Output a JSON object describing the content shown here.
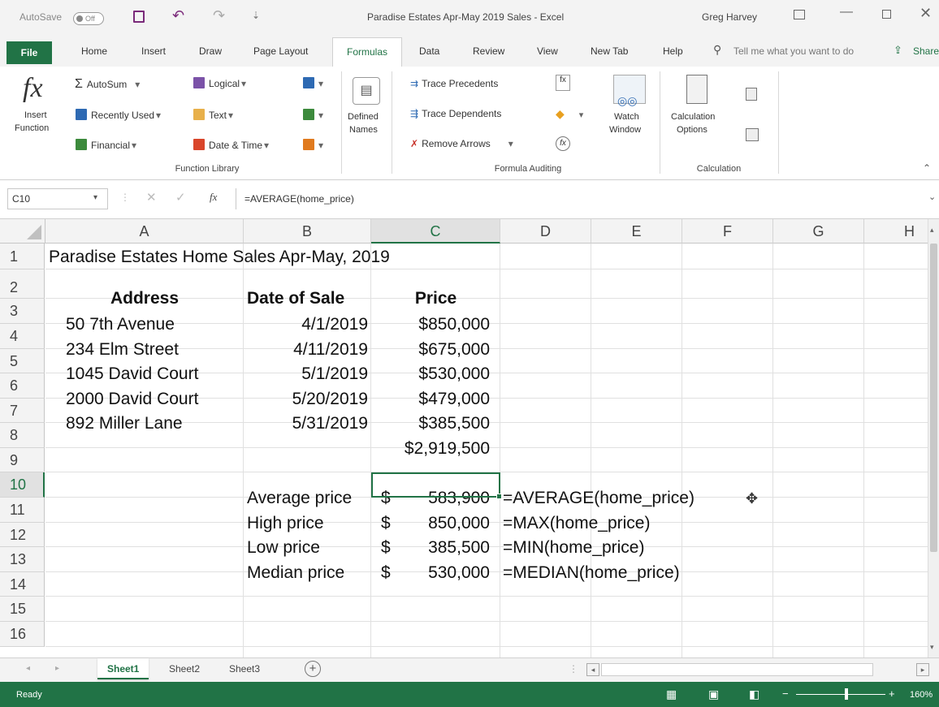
{
  "titlebar": {
    "autosave": "AutoSave",
    "autosave_state": "Off",
    "doc_title": "Paradise Estates Apr-May 2019 Sales  -  Excel",
    "user": "Greg Harvey"
  },
  "tabs": [
    "Home",
    "Insert",
    "Draw",
    "Page Layout",
    "Formulas",
    "Data",
    "Review",
    "View",
    "New Tab",
    "Help"
  ],
  "file_tab": "File",
  "active_tab": "Formulas",
  "tell_me": "Tell me what you want to do",
  "share": "Share",
  "ribbon": {
    "insert_function": [
      "Insert",
      "Function"
    ],
    "fx": "fx",
    "autosum": "AutoSum",
    "recently_used": "Recently Used",
    "financial": "Financial",
    "logical": "Logical",
    "text": "Text",
    "date_time": "Date & Time",
    "defined_names": [
      "Defined",
      "Names"
    ],
    "trace_precedents": "Trace Precedents",
    "trace_dependents": "Trace Dependents",
    "remove_arrows": "Remove Arrows",
    "watch_window": [
      "Watch",
      "Window"
    ],
    "calc_options": [
      "Calculation",
      "Options"
    ],
    "group_function_library": "Function Library",
    "group_formula_auditing": "Formula Auditing",
    "group_calculation": "Calculation"
  },
  "formula_bar": {
    "name_box": "C10",
    "fx": "fx",
    "formula": "=AVERAGE(home_price)"
  },
  "columns": [
    "A",
    "B",
    "C",
    "D",
    "E",
    "F",
    "G",
    "H"
  ],
  "rows": [
    "1",
    "2",
    "3",
    "4",
    "5",
    "6",
    "7",
    "8",
    "9",
    "10",
    "11",
    "12",
    "13",
    "14",
    "15",
    "16"
  ],
  "sheet": {
    "title": "Paradise Estates Home Sales Apr-May, 2019",
    "headers": {
      "address": "Address",
      "date": "Date of Sale",
      "price": "Price"
    },
    "sales": [
      {
        "address": "50 7th Avenue",
        "date": "4/1/2019",
        "price": "$850,000"
      },
      {
        "address": "234 Elm Street",
        "date": "4/11/2019",
        "price": "$675,000"
      },
      {
        "address": "1045 David Court",
        "date": "5/1/2019",
        "price": "$530,000"
      },
      {
        "address": "2000 David Court",
        "date": "5/20/2019",
        "price": "$479,000"
      },
      {
        "address": "892 Miller Lane",
        "date": "5/31/2019",
        "price": "$385,500"
      }
    ],
    "total": "$2,919,500",
    "stats": [
      {
        "label": "Average price",
        "currency": "$",
        "value": "583,900",
        "formula": "=AVERAGE(home_price)"
      },
      {
        "label": "High price",
        "currency": "$",
        "value": "850,000",
        "formula": "=MAX(home_price)"
      },
      {
        "label": "Low price",
        "currency": "$",
        "value": "385,500",
        "formula": "=MIN(home_price)"
      },
      {
        "label": "Median price",
        "currency": "$",
        "value": "530,000",
        "formula": "=MEDIAN(home_price)"
      }
    ]
  },
  "sheet_tabs": [
    "Sheet1",
    "Sheet2",
    "Sheet3"
  ],
  "active_sheet": "Sheet1",
  "status": {
    "ready": "Ready",
    "zoom": "160%"
  },
  "colors": {
    "excel_green": "#217346"
  }
}
